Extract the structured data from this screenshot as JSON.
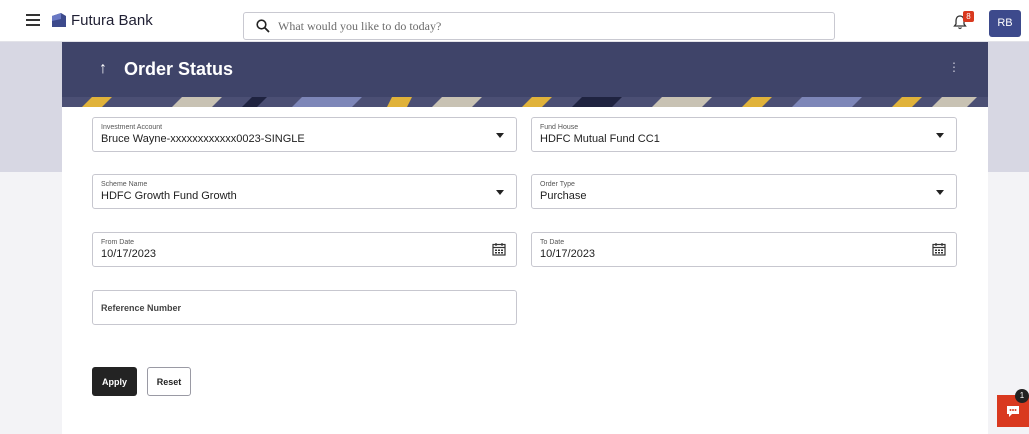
{
  "brand": {
    "name": "Futura Bank"
  },
  "search": {
    "placeholder": "What would you like to do today?"
  },
  "header": {
    "notification_count": "8",
    "user_initials": "RB"
  },
  "page": {
    "title": "Order Status",
    "back_glyph": "↑",
    "menu_glyph": "⋮"
  },
  "form": {
    "investment_account": {
      "label": "Investment Account",
      "value": "Bruce Wayne-xxxxxxxxxxxx0023-SINGLE"
    },
    "fund_house": {
      "label": "Fund House",
      "value": "HDFC Mutual Fund CC1"
    },
    "scheme_name": {
      "label": "Scheme Name",
      "value": "HDFC Growth Fund Growth"
    },
    "order_type": {
      "label": "Order Type",
      "value": "Purchase"
    },
    "from_date": {
      "label": "From Date",
      "value": "10/17/2023"
    },
    "to_date": {
      "label": "To Date",
      "value": "10/17/2023"
    },
    "reference_number": {
      "placeholder": "Reference Number"
    }
  },
  "actions": {
    "apply_label": "Apply",
    "reset_label": "Reset"
  },
  "chat": {
    "badge": "1"
  },
  "colors": {
    "header_band": "#3f4469",
    "accent_red": "#d9391f",
    "avatar_bg": "#3d4a8c",
    "primary_button": "#232323"
  },
  "icons": [
    "hamburger-icon",
    "bank-logo-icon",
    "search-icon",
    "bell-icon",
    "back-arrow-icon",
    "kebab-icon",
    "chevron-down-icon",
    "calendar-icon",
    "chat-icon"
  ]
}
